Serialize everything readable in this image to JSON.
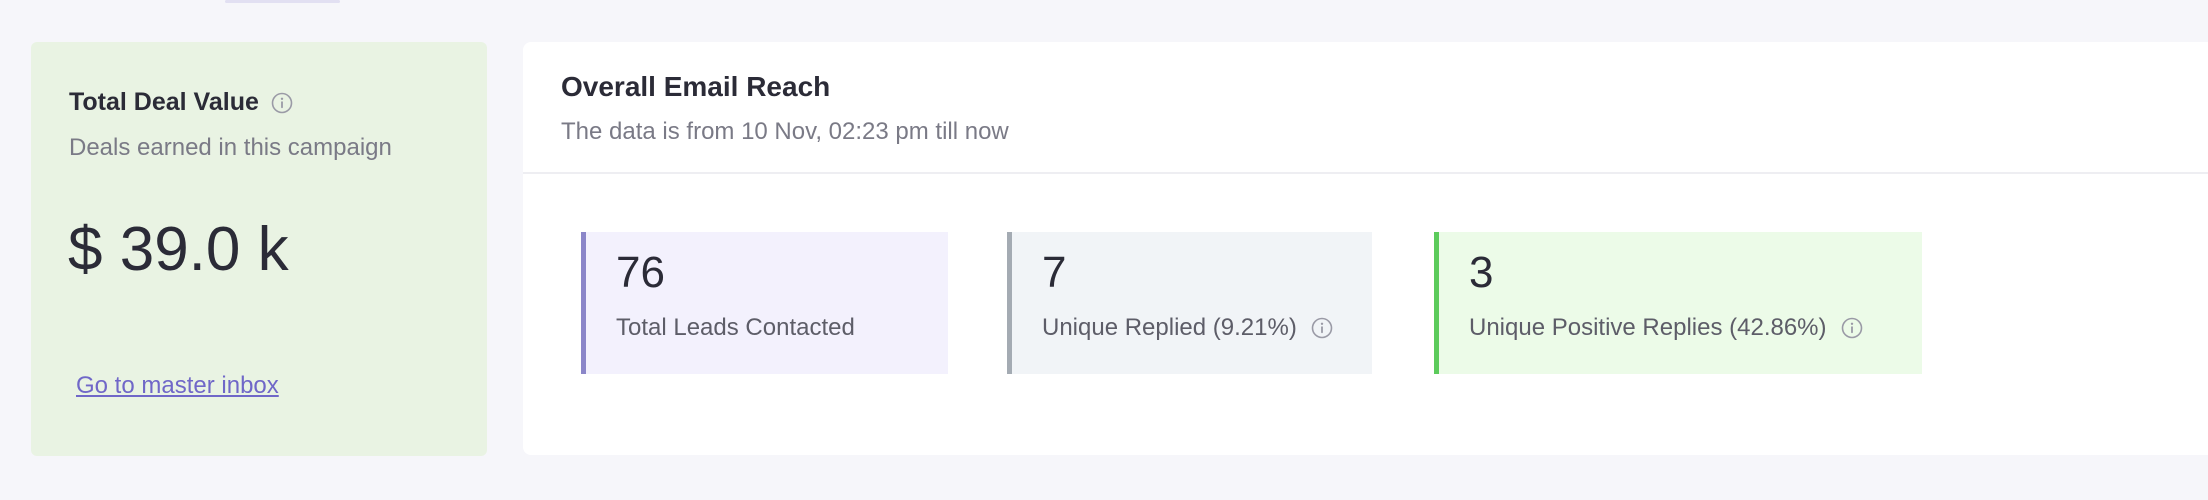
{
  "deal_card": {
    "title": "Total Deal Value",
    "subtitle": "Deals earned in this campaign",
    "amount": "$ 39.0 k",
    "link_label": "Go to master inbox",
    "icon": "info-icon"
  },
  "reach": {
    "title": "Overall Email Reach",
    "subtitle": "The data is from 10 Nov, 02:23 pm till now",
    "stats": [
      {
        "value": "76",
        "label": "Total Leads Contacted",
        "accent": "#8b86c9"
      },
      {
        "value": "7",
        "label": "Unique Replied (9.21%)",
        "accent": "#a4abb3",
        "icon": "info-icon"
      },
      {
        "value": "3",
        "label": "Unique Positive Replies (42.86%)",
        "accent": "#5ccb5b",
        "icon": "info-icon"
      }
    ]
  },
  "colors": {
    "deal_card_bg": "#e9f3e3",
    "link": "#7067c8",
    "page_bg": "#f6f6fa"
  }
}
